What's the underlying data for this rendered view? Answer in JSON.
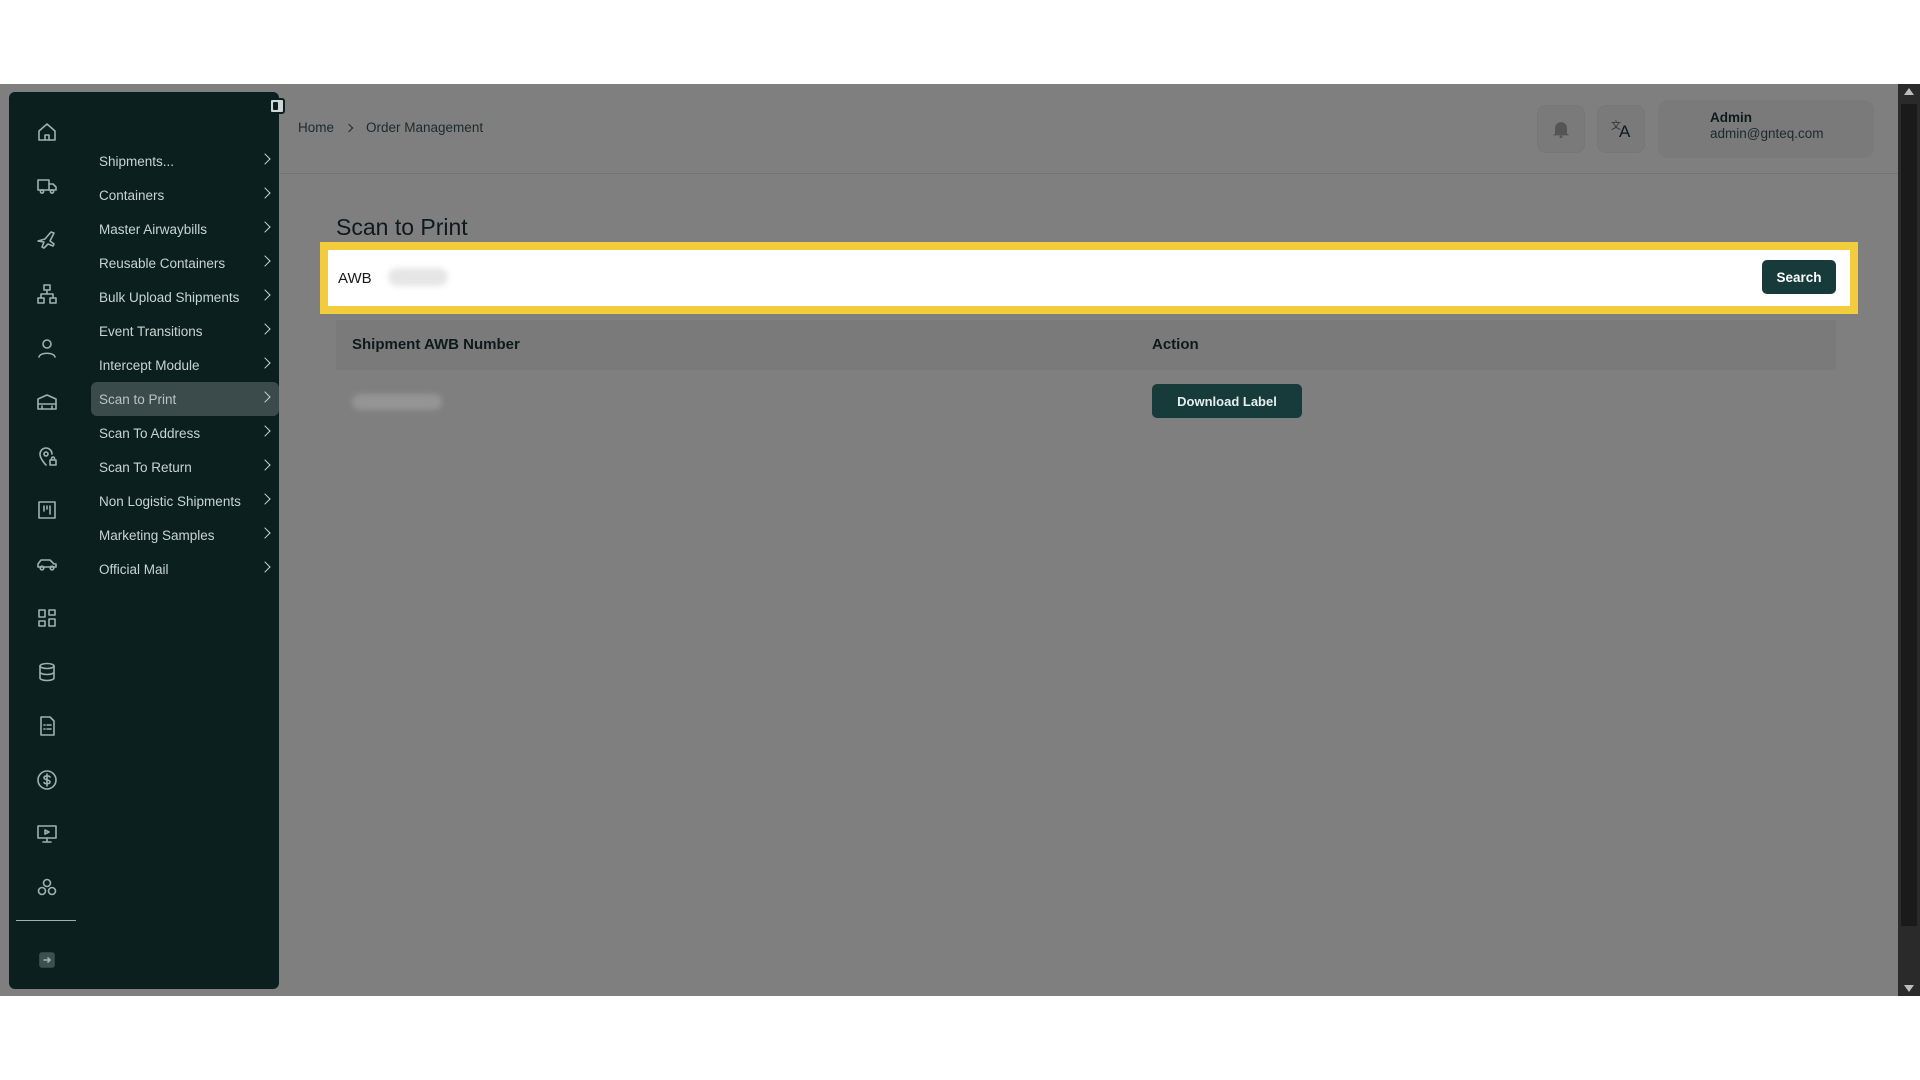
{
  "header": {
    "breadcrumb": [
      "Home",
      "Order Management"
    ],
    "user": {
      "name": "Admin",
      "email": "admin@gnteq.com"
    },
    "language_glyph": "A"
  },
  "sidebar": {
    "rail_icons": [
      "home-icon",
      "truck-icon",
      "airplane-icon",
      "network-icon",
      "user-icon",
      "warehouse-icon",
      "location-lock-icon",
      "kanban-icon",
      "car-icon",
      "grid-icon",
      "database-icon",
      "document-icon",
      "dollar-icon",
      "monitor-play-icon",
      "boxes-icon"
    ],
    "logout_icon": "logout-icon",
    "items": [
      {
        "label": "Shipments..."
      },
      {
        "label": "Containers"
      },
      {
        "label": "Master Airwaybills"
      },
      {
        "label": "Reusable Containers"
      },
      {
        "label": "Bulk Upload Shipments"
      },
      {
        "label": "Event Transitions"
      },
      {
        "label": "Intercept Module"
      },
      {
        "label": "Scan to Print",
        "active": true
      },
      {
        "label": "Scan To Address"
      },
      {
        "label": "Scan To Return"
      },
      {
        "label": "Non Logistic Shipments"
      },
      {
        "label": "Marketing Samples"
      },
      {
        "label": "Official Mail"
      }
    ]
  },
  "main": {
    "title": "Scan to Print",
    "search": {
      "value": "AWB",
      "button_label": "Search"
    },
    "table": {
      "columns": [
        "Shipment AWB Number",
        "Action"
      ],
      "rows": [
        {
          "action_label": "Download Label"
        }
      ]
    }
  },
  "colors": {
    "highlight": "#f2cc3c",
    "sidebar_bg": "#0c1f1f",
    "button_bg": "#173a3a"
  }
}
